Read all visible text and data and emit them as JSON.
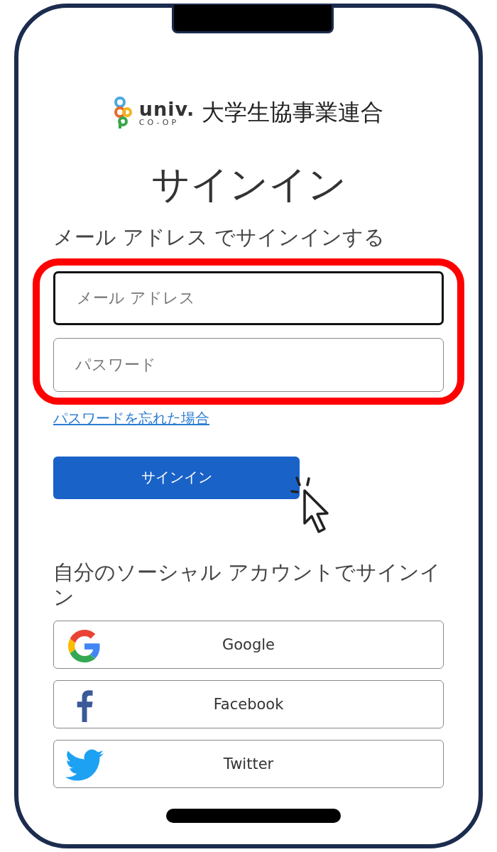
{
  "logo": {
    "wordmark": "univ.",
    "sub": "CO-OP",
    "organization": "大学生協事業連合"
  },
  "title": "サインイン",
  "email_section": {
    "heading": "メール アドレス でサインインする",
    "fields": [
      {
        "placeholder": "メール アドレス",
        "focused": true
      },
      {
        "placeholder": "パスワード",
        "focused": false
      }
    ],
    "highlighted": true,
    "forgot_link": "パスワードを忘れた場合",
    "submit": "サインイン"
  },
  "social_section": {
    "heading": "自分のソーシャル アカウントでサインイン",
    "providers": [
      {
        "kind": "google",
        "label": "Google"
      },
      {
        "kind": "facebook",
        "label": "Facebook"
      },
      {
        "kind": "twitter",
        "label": "Twitter"
      }
    ]
  }
}
